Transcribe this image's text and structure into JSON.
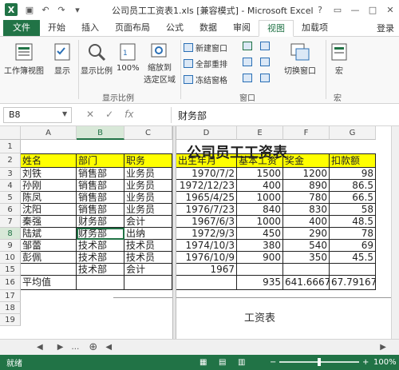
{
  "window": {
    "title": "公司员工工资表1.xls  [兼容模式] - Microsoft Excel",
    "app_icon": "excel-icon",
    "login": "登录",
    "controls": [
      "?",
      "▭",
      "—",
      "□",
      "✕"
    ]
  },
  "tabs": [
    {
      "label": "文件",
      "kind": "file"
    },
    {
      "label": "开始"
    },
    {
      "label": "插入"
    },
    {
      "label": "页面布局"
    },
    {
      "label": "公式"
    },
    {
      "label": "数据"
    },
    {
      "label": "审阅"
    },
    {
      "label": "视图",
      "active": true
    },
    {
      "label": "加载项"
    }
  ],
  "ribbon": {
    "workbook_views": "工作簿视图",
    "show": "显示",
    "zoom": "显示比例",
    "zoom100": "100%",
    "zoom_sel_1": "缩放到",
    "zoom_sel_2": "选定区域",
    "zoom_group": "显示比例",
    "new_window": "新建窗口",
    "arrange_all": "全部重排",
    "freeze": "冻结窗格",
    "switch_window": "切换窗口",
    "window_group": "窗口",
    "macro": "宏",
    "macro_group": "宏"
  },
  "formula_bar": {
    "name_box": "B8",
    "fx": "fx",
    "content": "财务部"
  },
  "columns_left": [
    "A",
    "B",
    "C"
  ],
  "columns_right": [
    "D",
    "E",
    "F",
    "G"
  ],
  "rows": [
    "1",
    "2",
    "3",
    "4",
    "5",
    "6",
    "7",
    "8",
    "9",
    "10",
    "15",
    "16",
    "17",
    "18",
    "19"
  ],
  "sheet": {
    "title": "公司员工工资表",
    "headers": [
      "姓名",
      "部门",
      "职务",
      "出生年月",
      "基本工资",
      "奖金",
      "扣款额"
    ],
    "data": [
      [
        "刘铁",
        "销售部",
        "业务员",
        "1970/7/2",
        "1500",
        "1200",
        "98"
      ],
      [
        "孙刚",
        "销售部",
        "业务员",
        "1972/12/23",
        "400",
        "890",
        "86.5"
      ],
      [
        "陈凤",
        "销售部",
        "业务员",
        "1965/4/25",
        "1000",
        "780",
        "66.5"
      ],
      [
        "沈阳",
        "销售部",
        "业务员",
        "1976/7/23",
        "840",
        "830",
        "58"
      ],
      [
        "秦强",
        "财务部",
        "会计",
        "1967/6/3",
        "1000",
        "400",
        "48.5"
      ],
      [
        "陆斌",
        "财务部",
        "出纳",
        "1972/9/3",
        "450",
        "290",
        "78"
      ],
      [
        "邹蕾",
        "技术部",
        "技术员",
        "1974/10/3",
        "380",
        "540",
        "69"
      ],
      [
        "彭佩",
        "技术部",
        "技术员",
        "1976/10/9",
        "900",
        "350",
        "45.5"
      ]
    ],
    "partial_row": [
      "",
      "技术部",
      "会计",
      "1967",
      "",
      "",
      ""
    ],
    "avg_row": [
      "平均值",
      "",
      "",
      "",
      "935",
      "641.6667",
      "67.79167"
    ]
  },
  "chart": {
    "title": "工资表"
  },
  "status": {
    "ready": "就绪",
    "zoom": "100%",
    "minus": "−",
    "plus": "+"
  }
}
